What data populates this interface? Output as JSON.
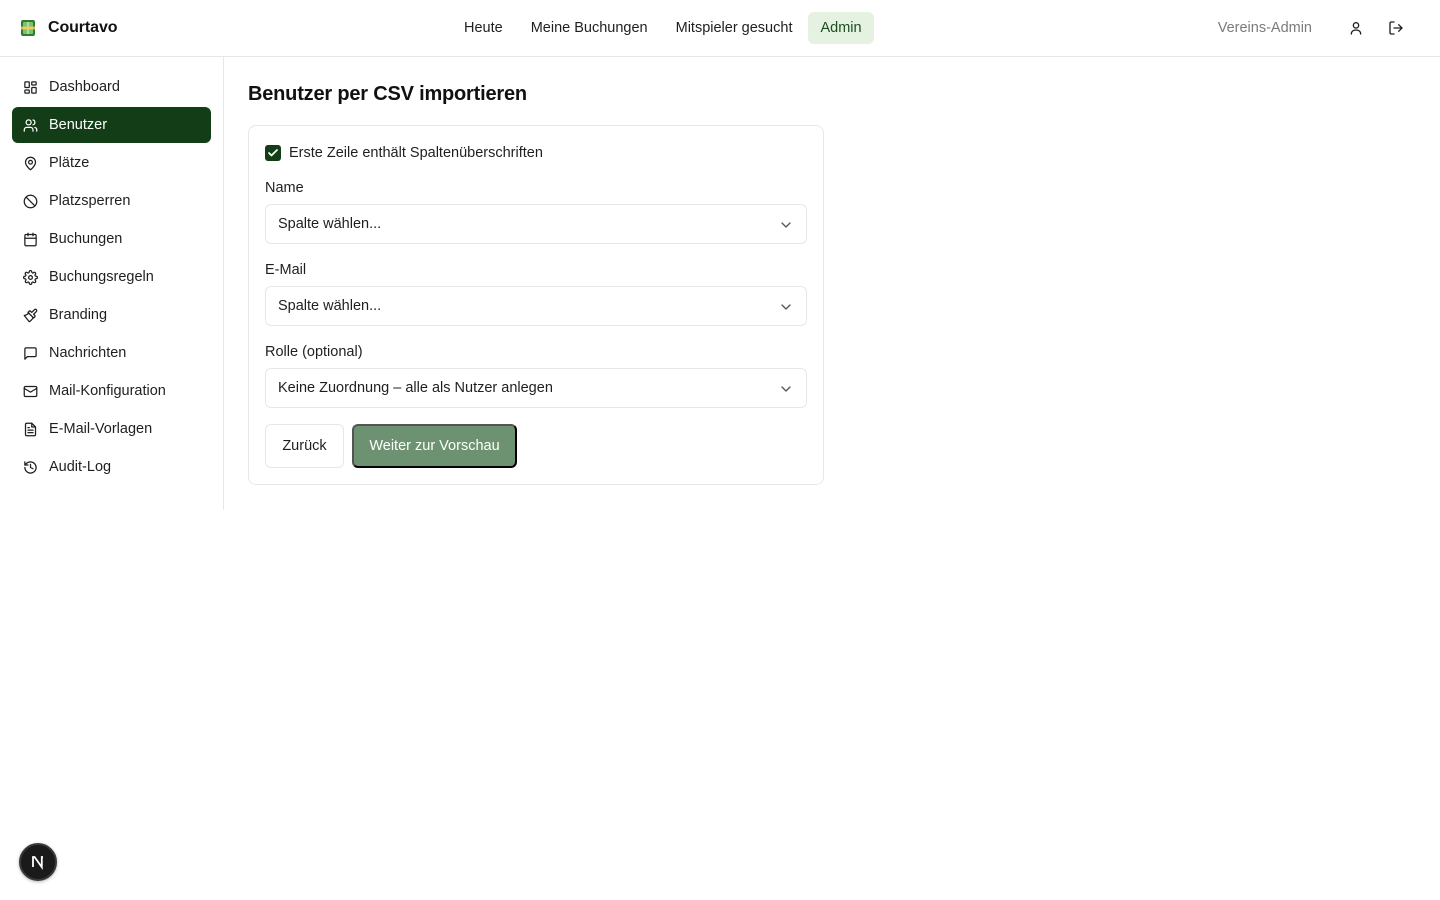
{
  "app": {
    "name": "Courtavo"
  },
  "topnav": {
    "items": [
      {
        "label": "Heute",
        "active": false
      },
      {
        "label": "Meine Buchungen",
        "active": false
      },
      {
        "label": "Mitspieler gesucht",
        "active": false
      },
      {
        "label": "Admin",
        "active": true
      }
    ],
    "role_label": "Vereins-Admin",
    "icons": [
      "user-icon",
      "logout-icon"
    ]
  },
  "sidebar": {
    "items": [
      {
        "label": "Dashboard",
        "icon": "dashboard-icon",
        "active": false
      },
      {
        "label": "Benutzer",
        "icon": "users-icon",
        "active": true
      },
      {
        "label": "Plätze",
        "icon": "map-pin-icon",
        "active": false
      },
      {
        "label": "Platzsperren",
        "icon": "ban-icon",
        "active": false
      },
      {
        "label": "Buchungen",
        "icon": "calendar-icon",
        "active": false
      },
      {
        "label": "Buchungsregeln",
        "icon": "settings-icon",
        "active": false
      },
      {
        "label": "Branding",
        "icon": "paintbrush-icon",
        "active": false
      },
      {
        "label": "Nachrichten",
        "icon": "message-icon",
        "active": false
      },
      {
        "label": "Mail-Konfiguration",
        "icon": "mail-icon",
        "active": false
      },
      {
        "label": "E-Mail-Vorlagen",
        "icon": "file-text-icon",
        "active": false
      },
      {
        "label": "Audit-Log",
        "icon": "history-icon",
        "active": false
      }
    ]
  },
  "main": {
    "title": "Benutzer per CSV importieren",
    "header_checkbox": {
      "label": "Erste Zeile enthält Spaltenüberschriften",
      "checked": true
    },
    "fields": [
      {
        "label": "Name",
        "value": "Spalte wählen..."
      },
      {
        "label": "E-Mail",
        "value": "Spalte wählen..."
      },
      {
        "label": "Rolle (optional)",
        "value": "Keine Zuordnung – alle als Nutzer anlegen"
      }
    ],
    "back_label": "Zurück",
    "next_label": "Weiter zur Vorschau"
  },
  "badge": {
    "letter": "N"
  },
  "colors": {
    "primary_dark": "#123d16",
    "primary_muted": "#6d9271",
    "active_nav_bg": "#e5f2e1",
    "border": "#e5e7eb"
  }
}
